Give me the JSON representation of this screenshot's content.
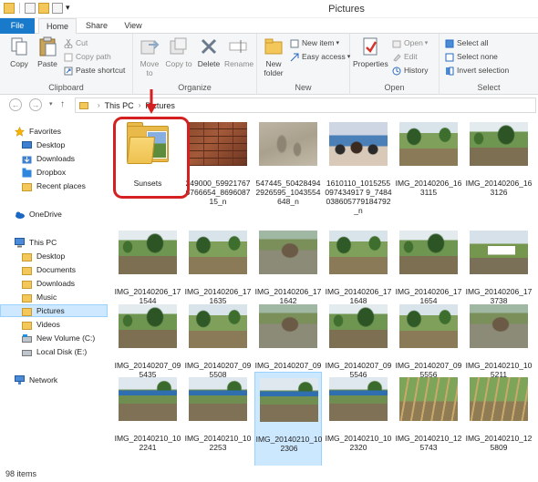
{
  "window": {
    "title": "Pictures"
  },
  "ribbon_tabs": [
    "File",
    "Home",
    "Share",
    "View"
  ],
  "ribbon": {
    "clipboard": {
      "label": "Clipboard",
      "copy": "Copy",
      "paste": "Paste",
      "cut": "Cut",
      "copy_path": "Copy path",
      "paste_shortcut": "Paste shortcut"
    },
    "organize": {
      "label": "Organize",
      "move_to": "Move to",
      "copy_to": "Copy to",
      "delete": "Delete",
      "rename": "Rename"
    },
    "new": {
      "label": "New",
      "new_folder": "New folder",
      "new_item": "New item",
      "easy_access": "Easy access"
    },
    "open": {
      "label": "Open",
      "properties": "Properties",
      "open": "Open",
      "edit": "Edit",
      "history": "History"
    },
    "select": {
      "label": "Select",
      "select_all": "Select all",
      "select_none": "Select none",
      "invert_selection": "Invert selection"
    }
  },
  "address": {
    "crumbs": [
      "This PC",
      "Pictures"
    ]
  },
  "nav": {
    "favorites": "Favorites",
    "favorites_items": [
      "Desktop",
      "Downloads",
      "Dropbox",
      "Recent places"
    ],
    "onedrive": "OneDrive",
    "thispc": "This PC",
    "thispc_items": [
      "Desktop",
      "Documents",
      "Downloads",
      "Music",
      "Pictures",
      "Videos",
      "New Volume (C:)",
      "Local Disk (E:)"
    ],
    "network": "Network"
  },
  "files": [
    {
      "name": "Sunsets",
      "kind": "folder"
    },
    {
      "name": "249000_599217676766654_869608715_n",
      "kind": "brick"
    },
    {
      "name": "547445_504284942926595_1043554648_n",
      "kind": "sand"
    },
    {
      "name": "1610110_1015255097434917 9_7484038605779184792_n",
      "kind": "crowd"
    },
    {
      "name": "IMG_20140206_163115",
      "kind": "rice"
    },
    {
      "name": "IMG_20140206_163126",
      "kind": "rice2"
    },
    {
      "name": "IMG_20140206_171544",
      "kind": "rice2"
    },
    {
      "name": "IMG_20140206_171635",
      "kind": "rice"
    },
    {
      "name": "IMG_20140206_171642",
      "kind": "dirt"
    },
    {
      "name": "IMG_20140206_171648",
      "kind": "rice"
    },
    {
      "name": "IMG_20140206_171654",
      "kind": "rice2"
    },
    {
      "name": "IMG_20140206_173738",
      "kind": "truck"
    },
    {
      "name": "IMG_20140207_095435",
      "kind": "rice2"
    },
    {
      "name": "IMG_20140207_095508",
      "kind": "rice"
    },
    {
      "name": "IMG_20140207_095534",
      "kind": "dirt"
    },
    {
      "name": "IMG_20140207_095546",
      "kind": "rice2"
    },
    {
      "name": "IMG_20140207_095556",
      "kind": "rice"
    },
    {
      "name": "IMG_20140210_105211",
      "kind": "dirt"
    },
    {
      "name": "IMG_20140210_102241",
      "kind": "tent"
    },
    {
      "name": "IMG_20140210_102253",
      "kind": "tent"
    },
    {
      "name": "IMG_20140210_102306",
      "kind": "tent"
    },
    {
      "name": "IMG_20140210_102320",
      "kind": "tent"
    },
    {
      "name": "IMG_20140210_125743",
      "kind": "bamboo"
    },
    {
      "name": "IMG_20140210_125809",
      "kind": "bamboo"
    }
  ],
  "status": {
    "item_count": "98 items"
  },
  "colors": {
    "accent": "#1979ca",
    "selection": "#cce8ff",
    "annotation": "#d42020"
  }
}
